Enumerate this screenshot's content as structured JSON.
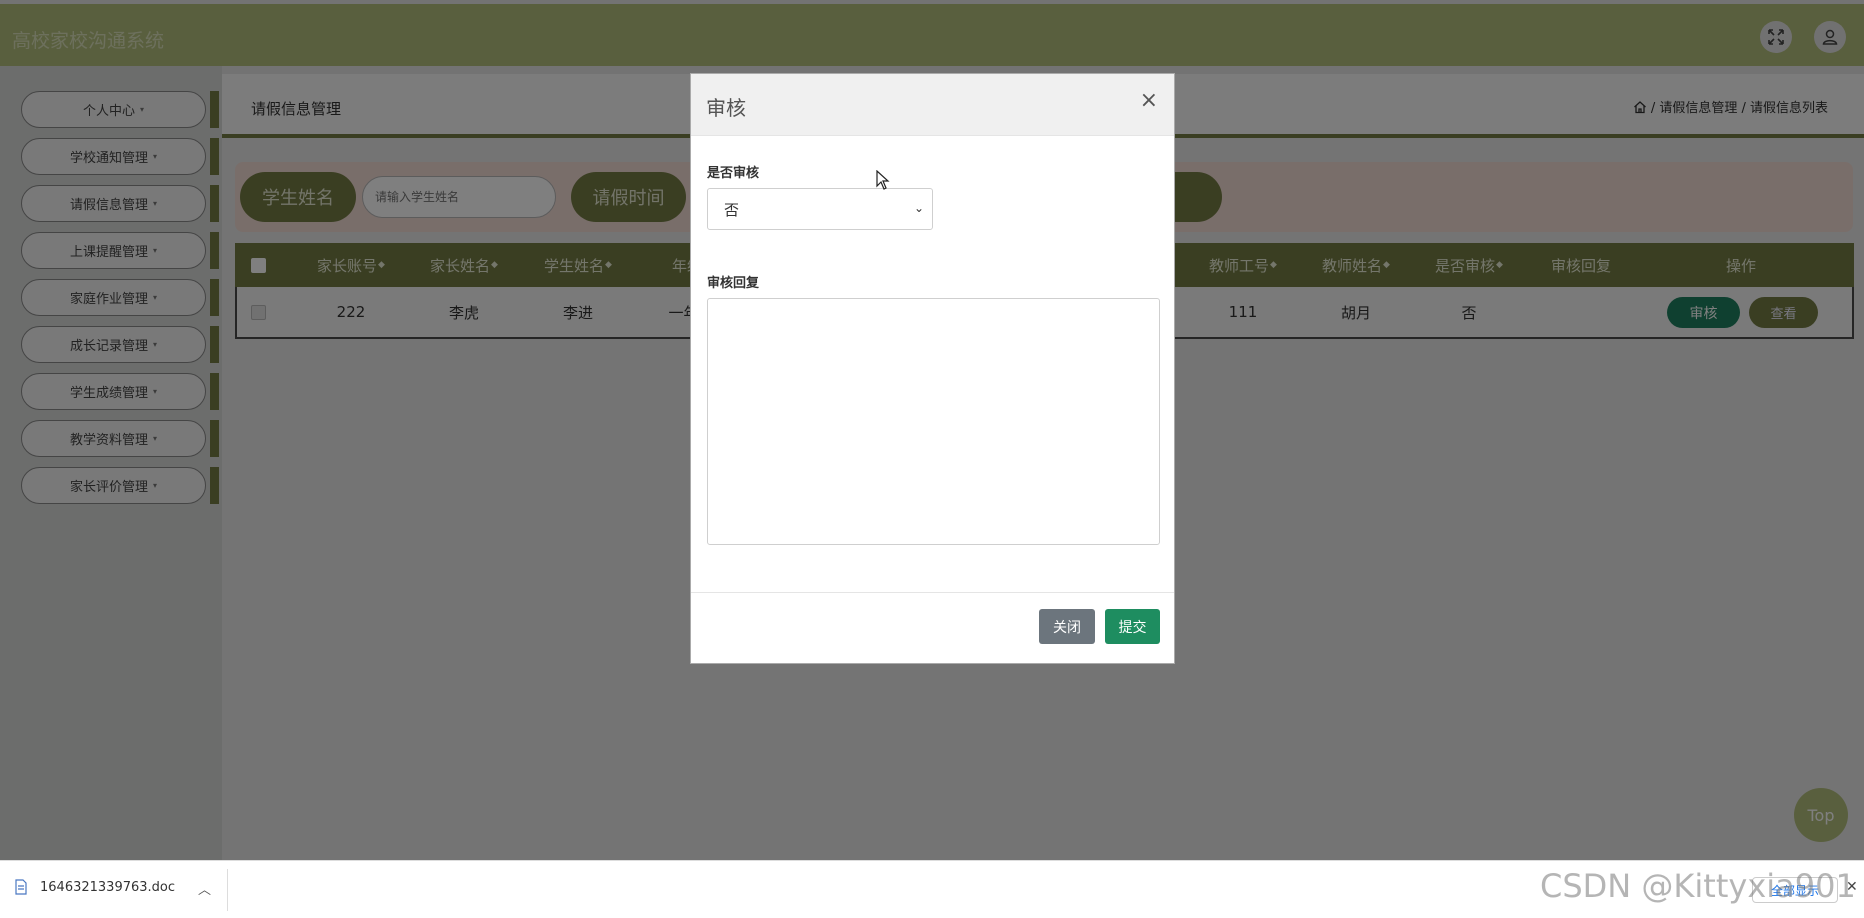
{
  "app": {
    "title": "高校家校沟通系统",
    "fullscreen_icon": "fullscreen-icon",
    "user_icon": "user-icon"
  },
  "sidebar": {
    "items": [
      {
        "label": "个人中心"
      },
      {
        "label": "学校通知管理"
      },
      {
        "label": "请假信息管理"
      },
      {
        "label": "上课提醒管理"
      },
      {
        "label": "家庭作业管理"
      },
      {
        "label": "成长记录管理"
      },
      {
        "label": "学生成绩管理"
      },
      {
        "label": "教学资料管理"
      },
      {
        "label": "家长评价管理"
      }
    ],
    "caret": "▾"
  },
  "page": {
    "title": "请假信息管理",
    "breadcrumb": "/ 请假信息管理 / 请假信息列表"
  },
  "search": {
    "student_name_label": "学生姓名",
    "student_name_placeholder": "请输入学生姓名",
    "leave_time_label": "请假时间"
  },
  "table": {
    "headers": [
      "家长账号",
      "家长姓名",
      "学生姓名",
      "年级",
      "教师工号",
      "教师姓名",
      "是否审核",
      "审核回复",
      "操作"
    ],
    "sort_glyph": "◆",
    "row": {
      "parent_account": "222",
      "parent_name": "李虎",
      "student_name": "李进",
      "grade": "一年级",
      "teacher_id": "111",
      "teacher_name": "胡月",
      "reviewed": "否",
      "reply": "",
      "audit_button": "审核",
      "view_button": "查看"
    }
  },
  "top_button": "Top",
  "modal": {
    "title": "审核",
    "close_glyph": "×",
    "reviewed_label": "是否审核",
    "reviewed_value": "否",
    "reply_label": "审核回复",
    "reply_value": "",
    "close_button": "关闭",
    "submit_button": "提交"
  },
  "download_bar": {
    "file_name": "1646321339763.doc",
    "chevron": "︿",
    "show_all": "全部显示",
    "close_glyph": "✕"
  },
  "watermark": "CSDN @Kittyxia901",
  "colors": {
    "header": "#b3bf7d",
    "accent": "#757d45",
    "audit": "#1f8060",
    "submit": "#1e8d60"
  }
}
